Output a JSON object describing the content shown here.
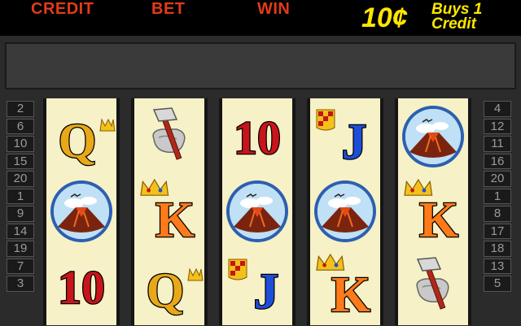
{
  "header": {
    "credit_label": "CREDIT",
    "bet_label": "BET",
    "win_label": "WIN",
    "denomination": "10¢",
    "buys_line1": "Buys 1",
    "buys_line2": "Credit"
  },
  "paylines_left": [
    "2",
    "6",
    "10",
    "15",
    "20",
    "1",
    "9",
    "14",
    "19",
    "7",
    "3"
  ],
  "paylines_right": [
    "4",
    "12",
    "11",
    "16",
    "20",
    "1",
    "8",
    "17",
    "18",
    "13",
    "5"
  ],
  "reels": [
    [
      "queen",
      "volcano",
      "ten"
    ],
    [
      "axe",
      "king",
      "queen"
    ],
    [
      "ten",
      "volcano",
      "jack"
    ],
    [
      "jack",
      "volcano",
      "king"
    ],
    [
      "volcano",
      "king",
      "axe"
    ]
  ],
  "symbol_text": {
    "queen": "Q",
    "king": "K",
    "jack": "J",
    "ten": "10"
  },
  "colors": {
    "header_label": "#e23b18",
    "denomination": "#ffe600",
    "reel_background": "#f6f1c6",
    "ten": "#c8141a",
    "jack": "#1e4ed8",
    "queen": "#e8a817",
    "king": "#ff7a1a"
  }
}
